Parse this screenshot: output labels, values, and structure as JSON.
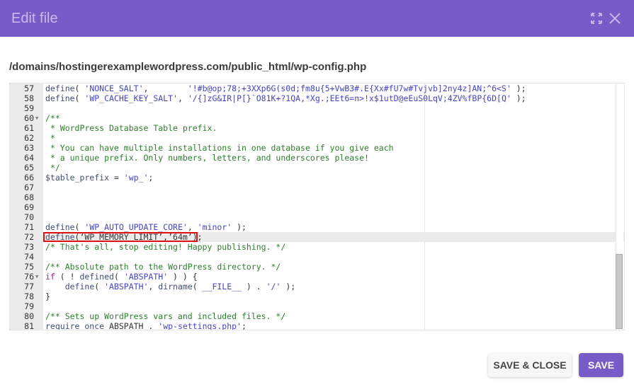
{
  "dialog": {
    "title": "Edit file",
    "expand_icon": "expand-icon",
    "close_icon": "close-icon"
  },
  "file_path": "/domains/hostingerexamplewordpress.com/public_html/wp-config.php",
  "colors": {
    "accent": "#775bc6",
    "highlight_box": "#e01010"
  },
  "editor": {
    "active_line": 72,
    "scroll_fraction": 0.95,
    "lines": [
      {
        "n": "57",
        "t": [
          [
            "kw",
            "define"
          ],
          [
            "pl",
            "( "
          ],
          [
            "str",
            "'NONCE_SALT'"
          ],
          [
            "pl",
            ",        "
          ],
          [
            "str",
            "'!#b@op;78;+3XXp6G(s0d;fm8u{5+VwB3#.E{Xx#fU7w#Tvjvb]2ny4z]AN;^6<S'"
          ],
          [
            "pl",
            " );"
          ]
        ]
      },
      {
        "n": "58",
        "t": [
          [
            "kw",
            "define"
          ],
          [
            "pl",
            "( "
          ],
          [
            "str",
            "'WP_CACHE_KEY_SALT'"
          ],
          [
            "pl",
            ", "
          ],
          [
            "str",
            "'/{]zG&IR|P[}`O81K+?1QA,*Xg.;EEt6=n>!x$1utD@eEuS0LqV;4ZV%fBP{6D[Q'"
          ],
          [
            "pl",
            " );"
          ]
        ]
      },
      {
        "n": "59",
        "t": []
      },
      {
        "n": "60",
        "fold": true,
        "t": [
          [
            "cm",
            "/**"
          ]
        ]
      },
      {
        "n": "61",
        "t": [
          [
            "cm",
            " * WordPress Database Table prefix."
          ]
        ]
      },
      {
        "n": "62",
        "t": [
          [
            "cm",
            " *"
          ]
        ]
      },
      {
        "n": "63",
        "t": [
          [
            "cm",
            " * You can have multiple installations in one database if you give each"
          ]
        ]
      },
      {
        "n": "64",
        "t": [
          [
            "cm",
            " * a unique prefix. Only numbers, letters, and underscores please!"
          ]
        ]
      },
      {
        "n": "65",
        "t": [
          [
            "cm",
            " */"
          ]
        ]
      },
      {
        "n": "66",
        "t": [
          [
            "kw",
            "$table_prefix"
          ],
          [
            "pl",
            " = "
          ],
          [
            "str",
            "'wp_'"
          ],
          [
            "pl",
            ";"
          ]
        ]
      },
      {
        "n": "67",
        "t": []
      },
      {
        "n": "68",
        "t": []
      },
      {
        "n": "69",
        "t": []
      },
      {
        "n": "70",
        "t": []
      },
      {
        "n": "71",
        "t": [
          [
            "kw",
            "define"
          ],
          [
            "pl",
            "( "
          ],
          [
            "str",
            "'WP_AUTO_UPDATE_CORE'"
          ],
          [
            "pl",
            ", "
          ],
          [
            "str",
            "'minor'"
          ],
          [
            "pl",
            " );"
          ]
        ]
      },
      {
        "n": "72",
        "t": [
          [
            "kw",
            "define"
          ],
          [
            "pl",
            "(‘WP_MEMORY_LIMIT’,’64m’);"
          ]
        ]
      },
      {
        "n": "73",
        "t": [
          [
            "cm",
            "/* That's all, stop editing! Happy publishing. */"
          ]
        ]
      },
      {
        "n": "74",
        "t": []
      },
      {
        "n": "75",
        "t": [
          [
            "cm",
            "/** Absolute path to the WordPress directory. */"
          ]
        ]
      },
      {
        "n": "76",
        "fold": true,
        "t": [
          [
            "ctl",
            "if"
          ],
          [
            "pl",
            " ( ! "
          ],
          [
            "kw",
            "defined"
          ],
          [
            "pl",
            "( "
          ],
          [
            "str",
            "'ABSPATH'"
          ],
          [
            "pl",
            " ) ) {"
          ]
        ]
      },
      {
        "n": "77",
        "t": [
          [
            "pl",
            "    "
          ],
          [
            "kw",
            "define"
          ],
          [
            "pl",
            "( "
          ],
          [
            "str",
            "'ABSPATH'"
          ],
          [
            "pl",
            ", "
          ],
          [
            "kw",
            "dirname"
          ],
          [
            "pl",
            "( "
          ],
          [
            "str",
            "__FILE__"
          ],
          [
            "pl",
            " ) . "
          ],
          [
            "str",
            "'/'"
          ],
          [
            "pl",
            " );"
          ]
        ]
      },
      {
        "n": "78",
        "t": [
          [
            "pl",
            "}"
          ]
        ]
      },
      {
        "n": "79",
        "t": []
      },
      {
        "n": "80",
        "t": [
          [
            "cm",
            "/** Sets up WordPress vars and included files. */"
          ]
        ]
      },
      {
        "n": "81",
        "t": [
          [
            "kw",
            "require_once"
          ],
          [
            "pl",
            " ABSPATH . "
          ],
          [
            "str",
            "'wp-settings.php'"
          ],
          [
            "pl",
            ";"
          ]
        ]
      }
    ]
  },
  "buttons": {
    "save_close": "SAVE & CLOSE",
    "save": "SAVE"
  }
}
